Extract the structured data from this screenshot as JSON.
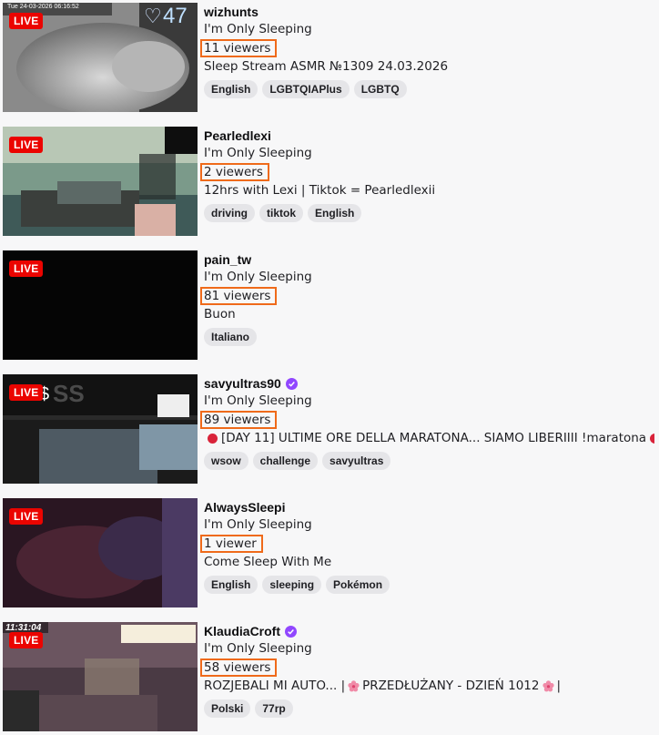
{
  "streams": [
    {
      "live_label": "LIVE",
      "channel": "wizhunts",
      "verified": false,
      "category": "I'm Only Sleeping",
      "viewers": "11 viewers",
      "title": "Sleep Stream ASMR №1309 24.03.2026",
      "tags": [
        "English",
        "LGBTQIAPlus",
        "LGBTQ"
      ],
      "overlay_date": "Tue 24-03-2026 06:16:52",
      "overlay_count": "47"
    },
    {
      "live_label": "LIVE",
      "channel": "Pearledlexi",
      "verified": false,
      "category": "I'm Only Sleeping",
      "viewers": "2 viewers",
      "title": "12hrs with Lexi | Tiktok = Pearledlexii",
      "tags": [
        "driving",
        "tiktok",
        "English"
      ]
    },
    {
      "live_label": "LIVE",
      "channel": "pain_tw",
      "verified": false,
      "category": "I'm Only Sleeping",
      "viewers": "81 viewers",
      "title": "Buon",
      "tags": [
        "Italiano"
      ]
    },
    {
      "live_label": "LIVE",
      "channel": "savyultras90",
      "verified": true,
      "category": "I'm Only Sleeping",
      "viewers": "89 viewers",
      "title": "[DAY 11] ULTIME ORE DELLA MARATONA... SIAMO LIBERIIII !maratona",
      "tags": [
        "wsow",
        "challenge",
        "savyultras"
      ]
    },
    {
      "live_label": "LIVE",
      "channel": "AlwaysSleepi",
      "verified": false,
      "category": "I'm Only Sleeping",
      "viewers": "1 viewer",
      "title": "Come Sleep With Me",
      "tags": [
        "English",
        "sleeping",
        "Pokémon"
      ]
    },
    {
      "live_label": "LIVE",
      "channel": "KlaudiaCroft",
      "verified": true,
      "category": "I'm Only Sleeping",
      "viewers": "58 viewers",
      "title_part1": "ROZJEBALI MI AUTO... |",
      "title_part2": "PRZEDŁUŻANY - DZIEŃ 1012",
      "title_part3": "|",
      "tags": [
        "Polski",
        "77rp"
      ],
      "overlay_time": "11:31:04"
    }
  ],
  "colors": {
    "live": "#eb0400",
    "highlight": "#ef6a1a",
    "verified": "#9147ff",
    "tag_bg": "#e5e5e8"
  }
}
